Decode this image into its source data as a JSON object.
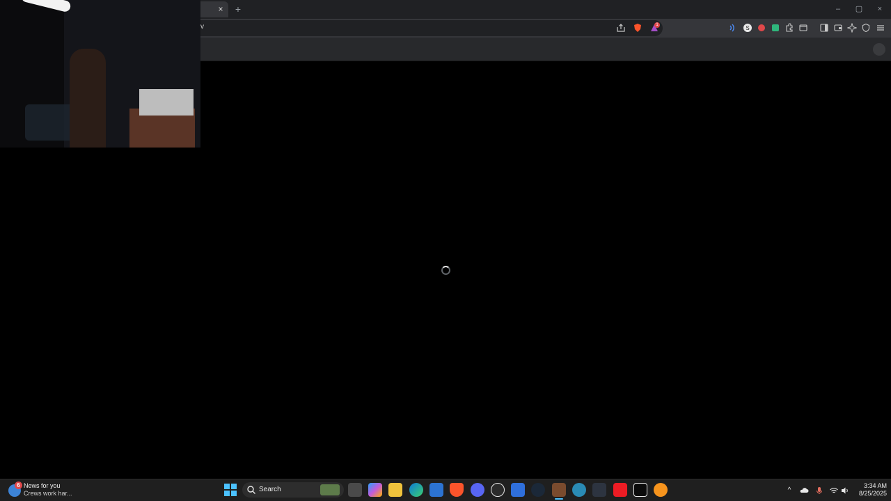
{
  "browser": {
    "tab_close": "×",
    "new_tab": "+",
    "address_text": "v",
    "window_controls": {
      "minimize": "–",
      "maximize": "▢",
      "close": "×"
    },
    "extension_badge": "1",
    "toolbar_icons": [
      "share-icon",
      "brave-shields-icon",
      "brave-rewards-icon",
      "sound-icon",
      "s-extension-icon",
      "record-icon",
      "green-extension-icon",
      "extensions-puzzle-icon",
      "tab-search-icon",
      "sidebar-icon",
      "wallet-icon",
      "leo-ai-icon",
      "vpn-shield-icon",
      "menu-icon"
    ]
  },
  "content": {
    "state": "loading"
  },
  "taskbar": {
    "news": {
      "title": "News for you",
      "subtitle": "Crews work har...",
      "badge": "6"
    },
    "search_label": "Search",
    "apps": [
      "task-view",
      "copilot",
      "file-explorer",
      "edge",
      "microsoft-store",
      "brave",
      "discord",
      "chatgpt",
      "todo",
      "steam",
      "game-app",
      "globe-app",
      "davinci-resolve",
      "amd-software",
      "capcut",
      "fl-studio"
    ],
    "tray_chevron": "^",
    "clock": {
      "time": "3:34 AM",
      "date": "8/25/2025"
    }
  },
  "colors": {
    "accent": "#4cc2ff",
    "brave": "#fb542b",
    "discord": "#5865f2",
    "steam": "#1b2838",
    "amd": "#ed1c24"
  }
}
